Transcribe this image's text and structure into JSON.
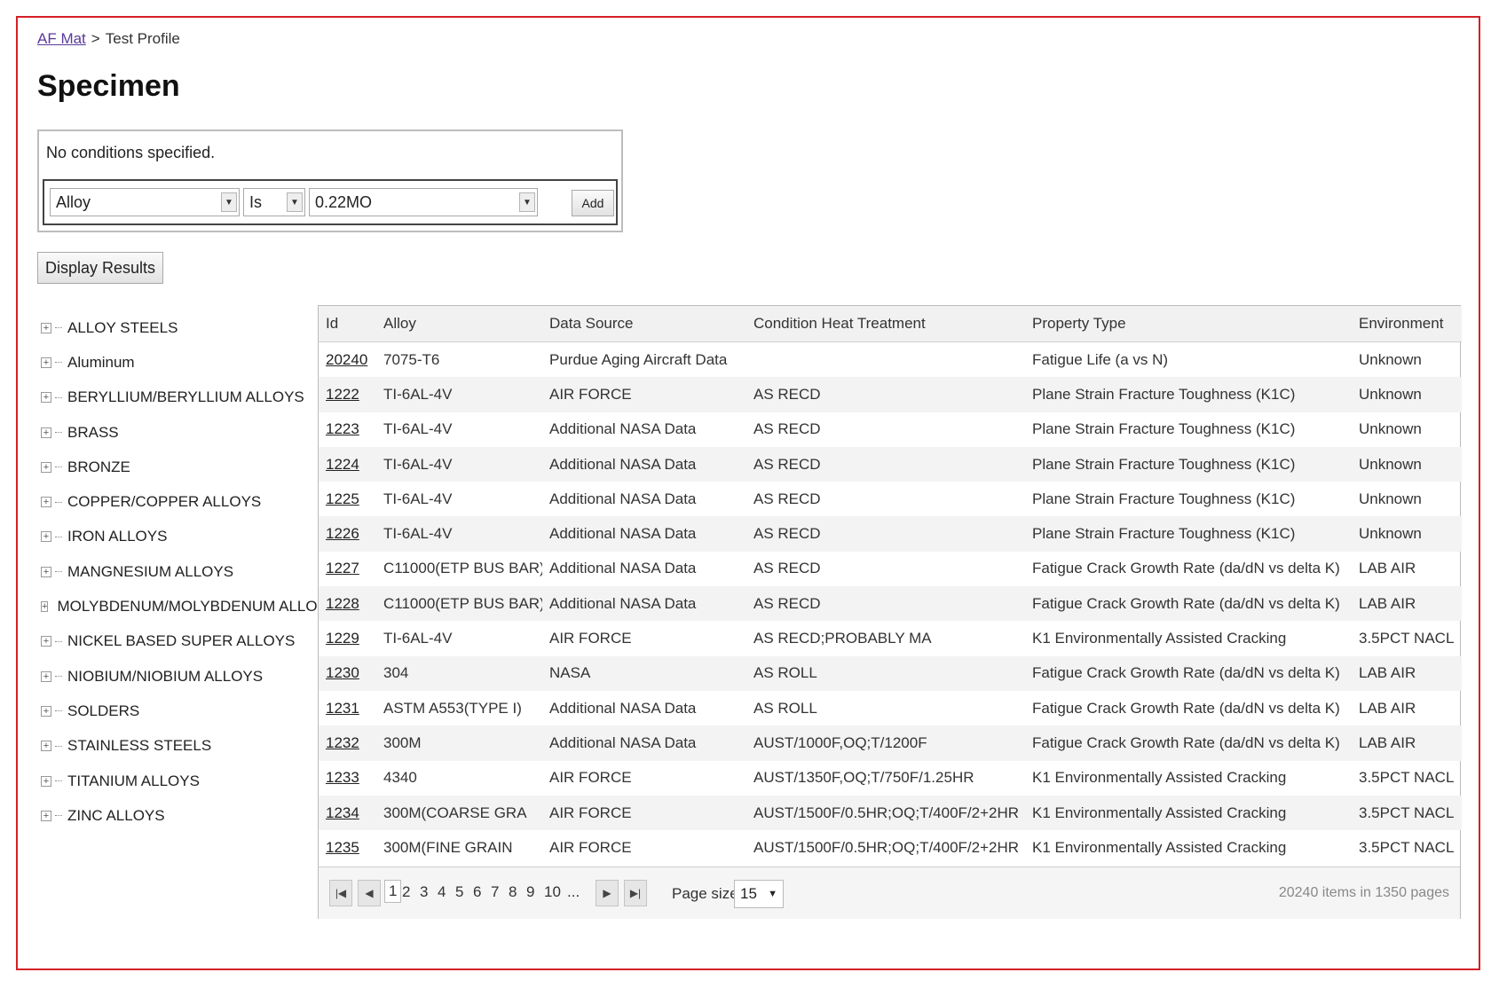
{
  "breadcrumb": {
    "root": "AF Mat",
    "separator": ">",
    "current": "Test Profile"
  },
  "page": {
    "title": "Specimen"
  },
  "conditions": {
    "message": "No conditions specified.",
    "field": "Alloy",
    "operator": "Is",
    "value": "0.22MO",
    "add_label": "Add"
  },
  "display_results_label": "Display Results",
  "tree": {
    "items": [
      "ALLOY STEELS",
      "Aluminum",
      "BERYLLIUM/BERYLLIUM ALLOYS",
      "BRASS",
      "BRONZE",
      "COPPER/COPPER ALLOYS",
      "IRON ALLOYS",
      "MANGNESIUM ALLOYS",
      "MOLYBDENUM/MOLYBDENUM ALLOYS",
      "NICKEL BASED SUPER ALLOYS",
      "NIOBIUM/NIOBIUM ALLOYS",
      "SOLDERS",
      "STAINLESS STEELS",
      "TITANIUM ALLOYS",
      "ZINC ALLOYS"
    ],
    "toggle_symbol": "+"
  },
  "grid": {
    "columns": [
      "Id",
      "Alloy",
      "Data Source",
      "Condition Heat Treatment",
      "Property Type",
      "Environment"
    ],
    "rows": [
      [
        "20240",
        "7075-T6",
        "Purdue Aging Aircraft Data",
        "",
        "Fatigue Life (a vs N)",
        "Unknown"
      ],
      [
        "1222",
        "TI-6AL-4V",
        "AIR FORCE",
        "AS RECD",
        "Plane Strain Fracture Toughness (K1C)",
        "Unknown"
      ],
      [
        "1223",
        "TI-6AL-4V",
        "Additional NASA Data",
        "AS RECD",
        "Plane Strain Fracture Toughness (K1C)",
        "Unknown"
      ],
      [
        "1224",
        "TI-6AL-4V",
        "Additional NASA Data",
        "AS RECD",
        "Plane Strain Fracture Toughness (K1C)",
        "Unknown"
      ],
      [
        "1225",
        "TI-6AL-4V",
        "Additional NASA Data",
        "AS RECD",
        "Plane Strain Fracture Toughness (K1C)",
        "Unknown"
      ],
      [
        "1226",
        "TI-6AL-4V",
        "Additional NASA Data",
        "AS RECD",
        "Plane Strain Fracture Toughness (K1C)",
        "Unknown"
      ],
      [
        "1227",
        "C11000(ETP BUS BAR)",
        "Additional NASA Data",
        "AS RECD",
        "Fatigue Crack Growth Rate (da/dN vs delta K)",
        "LAB AIR"
      ],
      [
        "1228",
        "C11000(ETP BUS BAR)",
        "Additional NASA Data",
        "AS RECD",
        "Fatigue Crack Growth Rate (da/dN vs delta K)",
        "LAB AIR"
      ],
      [
        "1229",
        "TI-6AL-4V",
        "AIR FORCE",
        "AS RECD;PROBABLY MA",
        "K1 Environmentally Assisted Cracking",
        "3.5PCT NACL"
      ],
      [
        "1230",
        "304",
        "NASA",
        "AS ROLL",
        "Fatigue Crack Growth Rate (da/dN vs delta K)",
        "LAB AIR"
      ],
      [
        "1231",
        "ASTM A553(TYPE I)",
        "Additional NASA Data",
        "AS ROLL",
        "Fatigue Crack Growth Rate (da/dN vs delta K)",
        "LAB AIR"
      ],
      [
        "1232",
        "300M",
        "Additional NASA Data",
        "AUST/1000F,OQ;T/1200F",
        "Fatigue Crack Growth Rate (da/dN vs delta K)",
        "LAB AIR"
      ],
      [
        "1233",
        "4340",
        "AIR FORCE",
        "AUST/1350F,OQ;T/750F/1.25HR",
        "K1 Environmentally Assisted Cracking",
        "3.5PCT NACL"
      ],
      [
        "1234",
        "300M(COARSE GRA",
        "AIR FORCE",
        "AUST/1500F/0.5HR;OQ;T/400F/2+2HR",
        "K1 Environmentally Assisted Cracking",
        "3.5PCT NACL"
      ],
      [
        "1235",
        "300M(FINE GRAIN",
        "AIR FORCE",
        "AUST/1500F/0.5HR;OQ;T/400F/2+2HR",
        "K1 Environmentally Assisted Cracking",
        "3.5PCT NACL"
      ]
    ]
  },
  "pager": {
    "first_icon": "first-page-icon",
    "prev_icon": "prev-page-icon",
    "next_icon": "next-page-icon",
    "last_icon": "last-page-icon",
    "pages": [
      "1",
      "2",
      "3",
      "4",
      "5",
      "6",
      "7",
      "8",
      "9",
      "10",
      "..."
    ],
    "current_page": "1",
    "page_size_label": "Page size",
    "page_size": "15",
    "info": "20240 items in 1350 pages"
  },
  "colors": {
    "frame_border": "#d42026",
    "breadcrumb_link": "#5a3a9a"
  }
}
